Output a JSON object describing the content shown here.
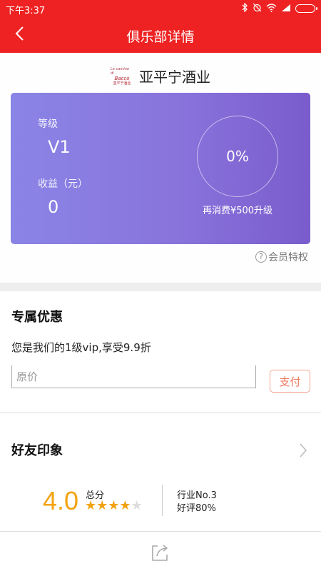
{
  "status_bar": {
    "time": "下午3:37",
    "icons": [
      "bluetooth-icon",
      "alarm-icon",
      "wifi-icon",
      "signal-icon",
      "battery-icon"
    ]
  },
  "nav": {
    "title": "俱乐部详情",
    "back_icon": "chevron-left-icon",
    "color": "#ee2222"
  },
  "club": {
    "logo_text": [
      "Le cantine di",
      "Bacco",
      "亚平宁酒业"
    ],
    "name": "亚平宁酒业"
  },
  "member_card": {
    "level_label": "等级",
    "level_value": "V1",
    "income_label": "收益（元）",
    "income_value": "0",
    "progress_text": "0%",
    "progress_fraction": 0,
    "upgrade_hint": "再消费¥500升级",
    "gradient": [
      "#8a84e6",
      "#7a5ccc"
    ]
  },
  "privilege_link": {
    "icon": "question-circle-icon",
    "label": "会员特权"
  },
  "discount": {
    "title": "专属优惠",
    "description": "您是我们的1级vip,享受9.9折",
    "price_placeholder": "原价",
    "price_value": "",
    "pay_label": "支付"
  },
  "impression": {
    "title": "好友印象",
    "chevron_icon": "chevron-right-icon",
    "score": "4.0",
    "total_label": "总分",
    "stars_filled": 4,
    "stars_total": 5,
    "industry_rank": "行业No.3",
    "good_rate": "好评80%",
    "accent": "#f3a20f"
  },
  "bottom_bar": {
    "share_icon": "share-icon"
  }
}
